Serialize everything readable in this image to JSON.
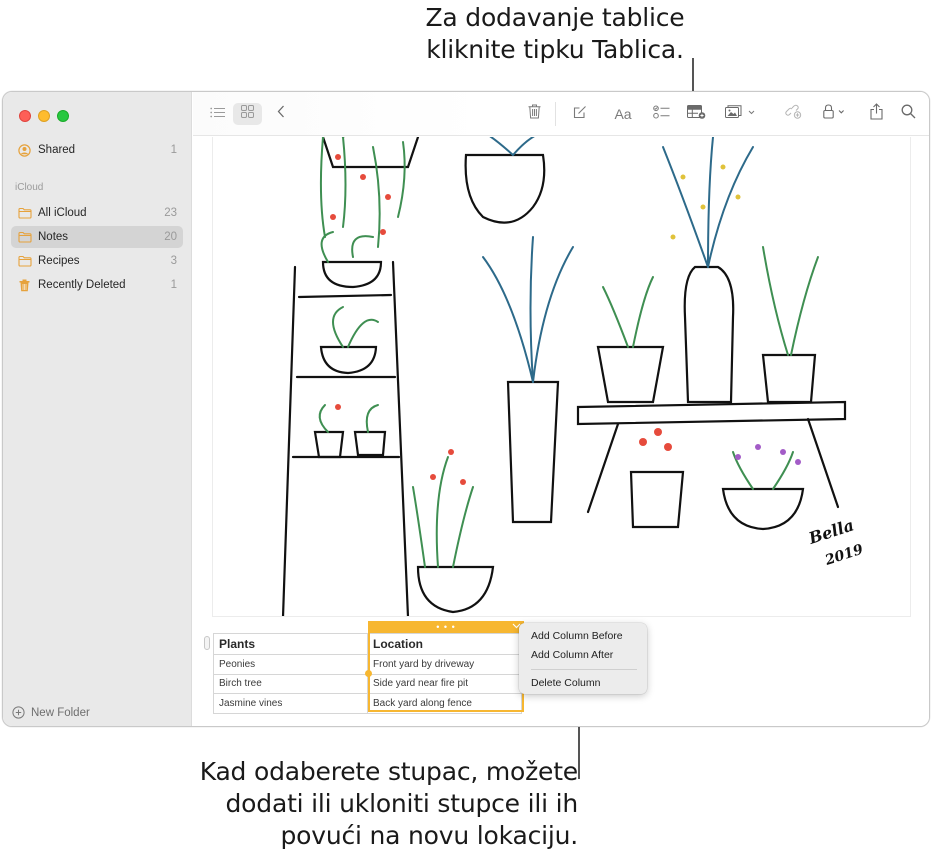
{
  "callouts": {
    "top": [
      "Za dodavanje tablice",
      "kliknite tipku Tablica."
    ],
    "bottom": [
      "Kad odaberete stupac, možete",
      "dodati ili ukloniti stupce ili ih",
      "povući na novu lokaciju."
    ]
  },
  "colors": {
    "accent": "#f7b731",
    "folder_icon": "#e6a23c",
    "close": "#fe5f57",
    "minimize": "#febc2e",
    "zoom": "#28c840"
  },
  "sidebar": {
    "shared": {
      "label": "Shared",
      "count": "1",
      "icon": "person-circle-icon"
    },
    "section_label": "iCloud",
    "folders": [
      {
        "label": "All iCloud",
        "count": "23",
        "icon": "folder-icon",
        "selected": false
      },
      {
        "label": "Notes",
        "count": "20",
        "icon": "folder-icon",
        "selected": true
      },
      {
        "label": "Recipes",
        "count": "3",
        "icon": "folder-icon",
        "selected": false
      },
      {
        "label": "Recently Deleted",
        "count": "1",
        "icon": "trash-icon",
        "selected": false
      }
    ],
    "new_folder_label": "New Folder"
  },
  "toolbar": {
    "left": [
      "list-view-icon",
      "gallery-view-icon",
      "back-icon"
    ],
    "right": [
      "delete-icon",
      "compose-icon",
      "format-icon",
      "checklist-icon",
      "table-icon",
      "media-icon",
      "collaborate-icon",
      "lock-icon",
      "share-icon",
      "search-icon"
    ],
    "format_label": "Aa"
  },
  "note": {
    "drawing": {
      "signature": "Bella",
      "year": "2019"
    },
    "table": {
      "headers": [
        "Plants",
        "Location"
      ],
      "rows": [
        [
          "Peonies",
          "Front yard by driveway"
        ],
        [
          "Birch tree",
          "Side yard near fire pit"
        ],
        [
          "Jasmine vines",
          "Back yard along fence"
        ]
      ],
      "selected_column": 1,
      "column_handle": "• • •"
    },
    "context_menu": {
      "items": [
        "Add Column Before",
        "Add Column After"
      ],
      "destructive": [
        "Delete Column"
      ]
    }
  }
}
